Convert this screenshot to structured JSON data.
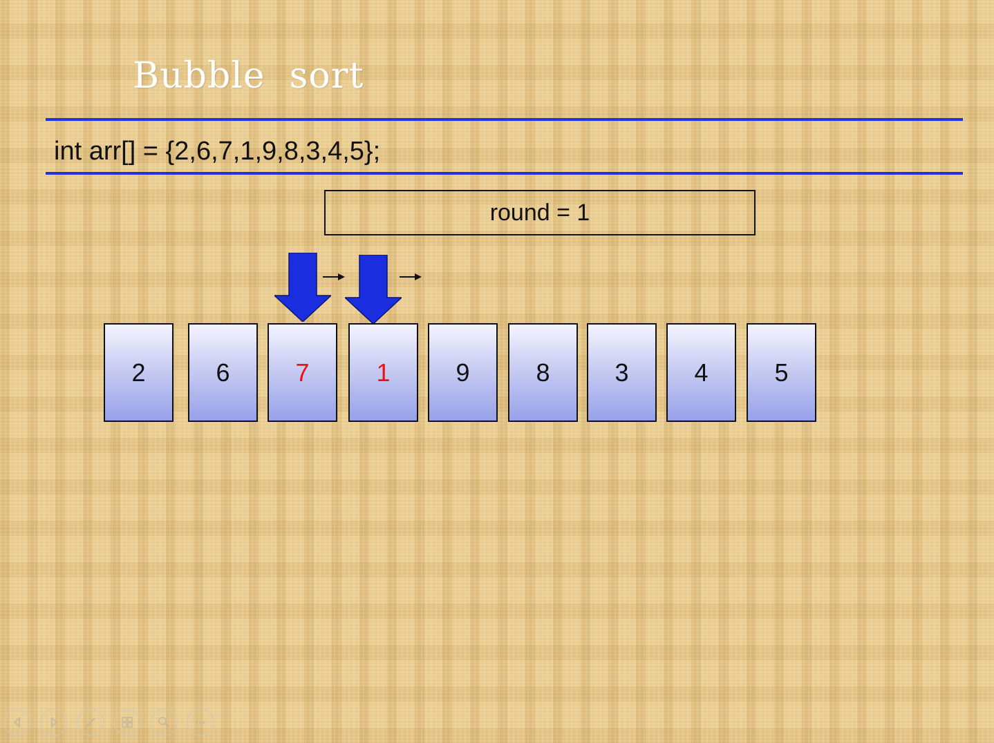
{
  "slide": {
    "title": "Bubble  sort",
    "code": "int arr[] = {2,6,7,1,9,8,3,4,5};",
    "round_label": "round = 1"
  },
  "array": {
    "values": [
      "2",
      "6",
      "7",
      "1",
      "9",
      "8",
      "3",
      "4",
      "5"
    ],
    "highlighted_indices": [
      2,
      3
    ],
    "highlight_color": "#ee1111",
    "cell_color_top": "#f4f4fe",
    "cell_color_bottom": "#97a1ea"
  },
  "pointers": {
    "color": "#1a2ee0",
    "direction_marker": "right-arrow"
  },
  "colors": {
    "rule": "#2233dd",
    "background": "#e8c98a"
  },
  "controls": {
    "icons": [
      "previous-icon",
      "next-icon",
      "pen-icon",
      "slides-icon",
      "zoom-icon",
      "more-icon"
    ]
  }
}
